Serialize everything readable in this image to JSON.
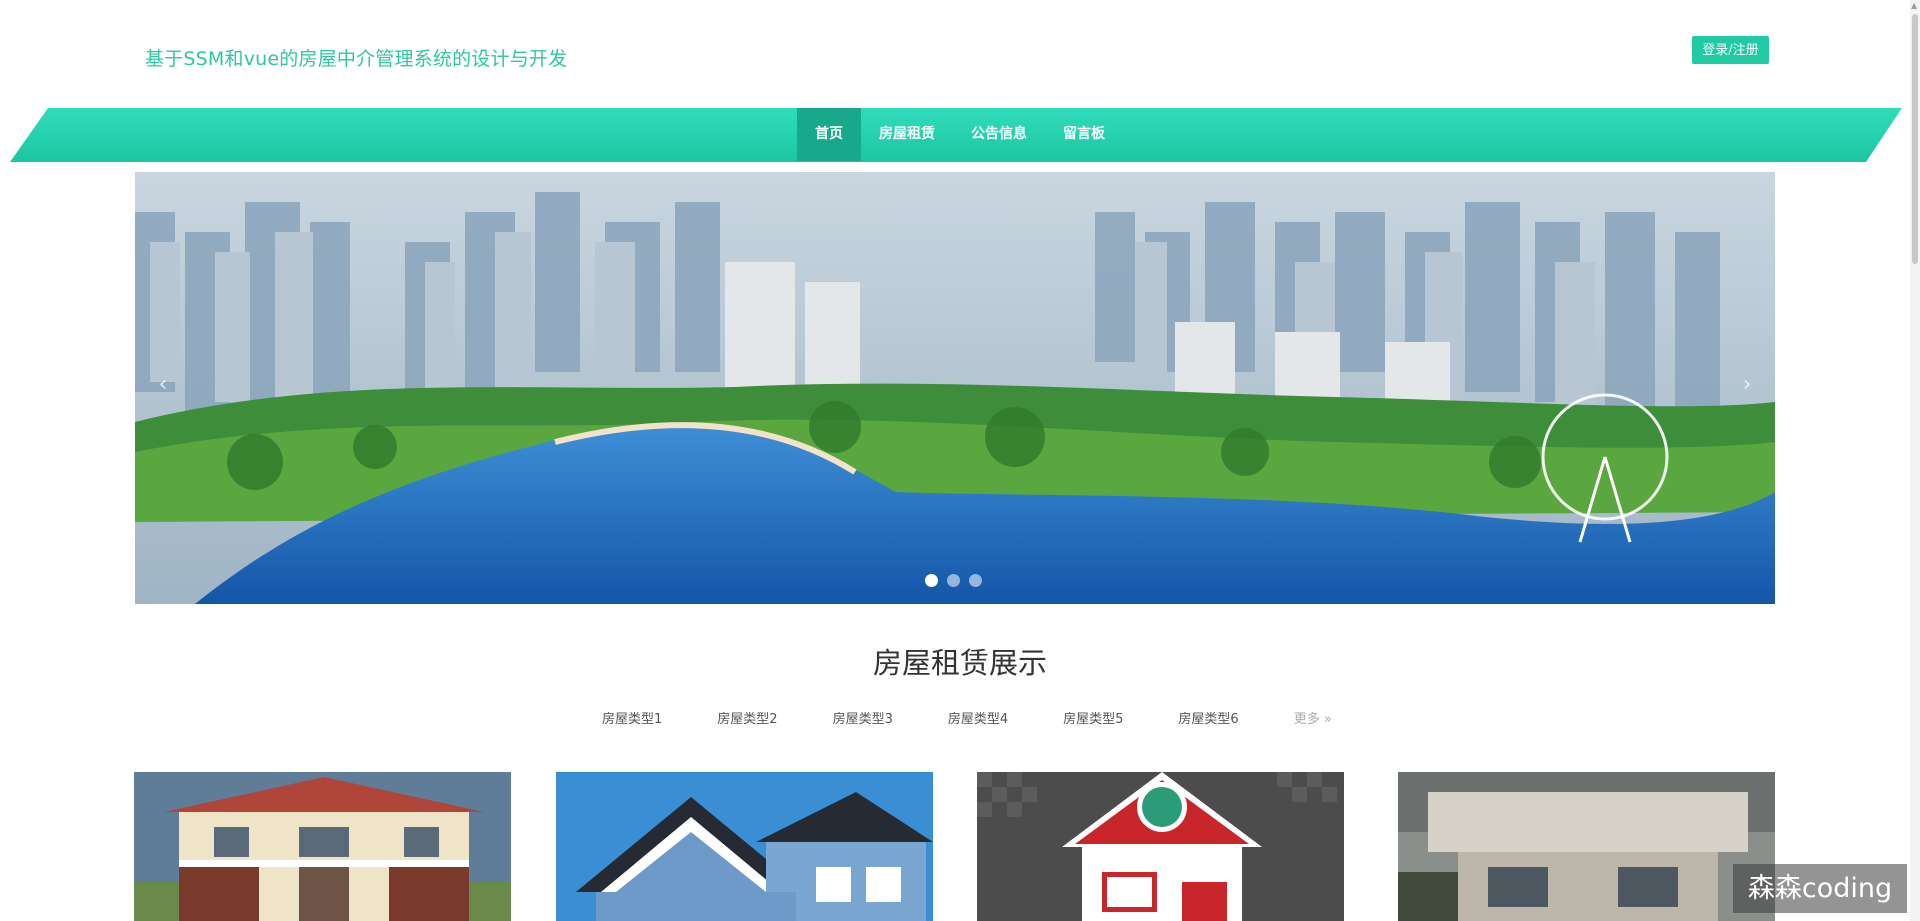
{
  "header": {
    "site_title": "基于SSM和vue的房屋中介管理系统的设计与开发",
    "login_label": "登录/注册"
  },
  "nav": {
    "items": [
      {
        "label": "首页",
        "active": true
      },
      {
        "label": "房屋租赁",
        "active": false
      },
      {
        "label": "公告信息",
        "active": false
      },
      {
        "label": "留言板",
        "active": false
      }
    ]
  },
  "banner": {
    "prev_glyph": "‹",
    "next_glyph": "›",
    "slide_count": 3,
    "active_slide": 1
  },
  "section": {
    "title": "房屋租赁展示",
    "tabs": [
      "房屋类型1",
      "房屋类型2",
      "房屋类型3",
      "房屋类型4",
      "房屋类型5",
      "房屋类型6"
    ],
    "more_label": "更多 »"
  },
  "watermark": "森森coding",
  "colors": {
    "accent": "#1fcaa5",
    "title_text": "#2fc7a3",
    "nav_active": "#18a88c"
  }
}
